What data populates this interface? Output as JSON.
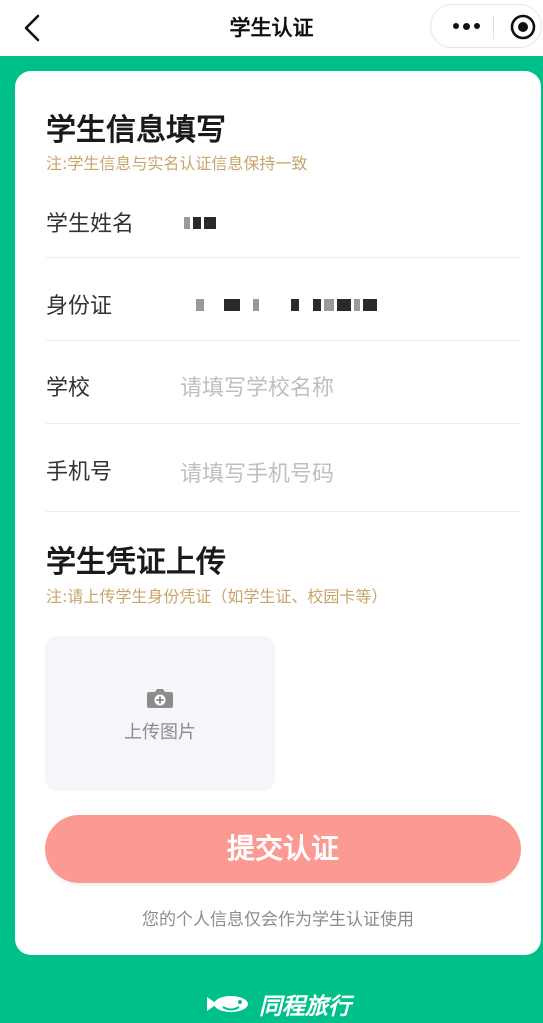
{
  "header": {
    "title": "学生认证",
    "back_icon": "chevron-left-icon",
    "more_icon": "more-dots-icon",
    "close_icon": "target-circle-icon"
  },
  "info_section": {
    "title": "学生信息填写",
    "note": "注:学生信息与实名认证信息保持一致",
    "fields": [
      {
        "label": "学生姓名",
        "value": "",
        "placeholder": ""
      },
      {
        "label": "身份证",
        "value": "",
        "placeholder": ""
      },
      {
        "label": "学校",
        "value": "",
        "placeholder": "请填写学校名称"
      },
      {
        "label": "手机号",
        "value": "",
        "placeholder": "请填写手机号码"
      }
    ]
  },
  "upload_section": {
    "title": "学生凭证上传",
    "note": "注:请上传学生身份凭证（如学生证、校园卡等）",
    "upload_label": "上传图片",
    "upload_icon": "camera-plus-icon"
  },
  "submit_label": "提交认证",
  "privacy_note": "您的个人信息仅会作为学生认证使用",
  "brand": {
    "name": "同程旅行",
    "logo_icon": "tongcheng-logo-icon"
  },
  "colors": {
    "brand_green": "#00c08a",
    "note_gold": "#c8a46b",
    "submit_bg": "#fb9a93",
    "placeholder": "#bfbfbf"
  }
}
